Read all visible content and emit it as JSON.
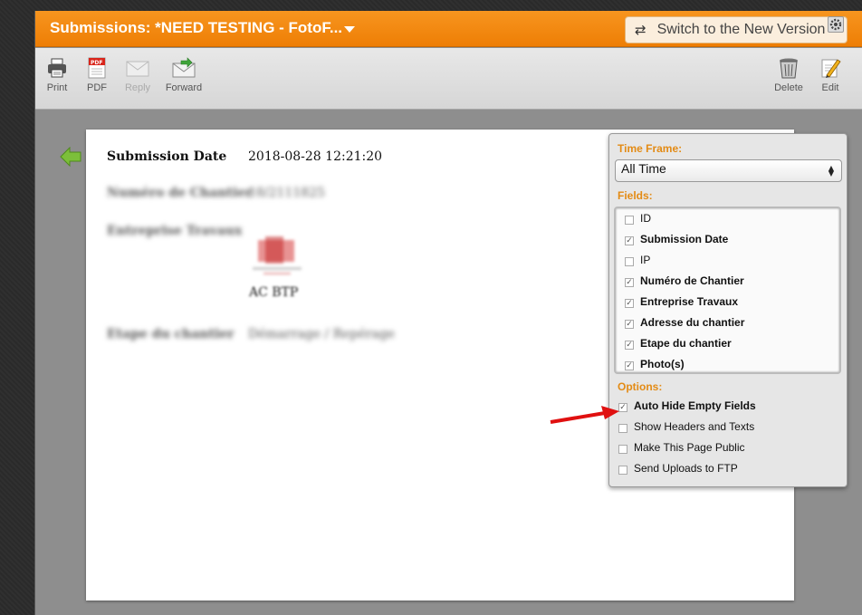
{
  "titlebar": {
    "title": "Submissions: *NEED TESTING - FotoF...",
    "switch_label": "Switch to the New Version"
  },
  "toolbar": {
    "print": "Print",
    "pdf": "PDF",
    "reply": "Reply",
    "forward": "Forward",
    "delete": "Delete",
    "edit": "Edit"
  },
  "submission": {
    "date_label": "Submission Date",
    "date_value": "2018-08-28 12:21:20",
    "chantier_label": "Numéro de Chantier",
    "chantier_value": "18/2111825",
    "entreprise_label": "Entreprise Travaux",
    "entreprise_value": "AC BTP",
    "etape_label": "Etape du chantier",
    "etape_value": "Démarrage / Repérage"
  },
  "panel": {
    "timeframe_label": "Time Frame:",
    "timeframe_value": "All Time",
    "fields_label": "Fields:",
    "fields": [
      {
        "label": "ID",
        "checked": false
      },
      {
        "label": "Submission Date",
        "checked": true
      },
      {
        "label": "IP",
        "checked": false
      },
      {
        "label": "Numéro de Chantier",
        "checked": true
      },
      {
        "label": "Entreprise Travaux",
        "checked": true
      },
      {
        "label": "Adresse du chantier",
        "checked": true
      },
      {
        "label": "Etape du chantier",
        "checked": true
      },
      {
        "label": "Photo(s)",
        "checked": true
      }
    ],
    "options_label": "Options:",
    "options": [
      {
        "label": "Auto Hide Empty Fields",
        "checked": true
      },
      {
        "label": "Show Headers and Texts",
        "checked": false
      },
      {
        "label": "Make This Page Public",
        "checked": false
      },
      {
        "label": "Send Uploads to FTP",
        "checked": false
      }
    ]
  },
  "colors": {
    "accent_orange": "#f28a10",
    "section_orange": "#e38b15",
    "annotation_red": "#e01010"
  }
}
